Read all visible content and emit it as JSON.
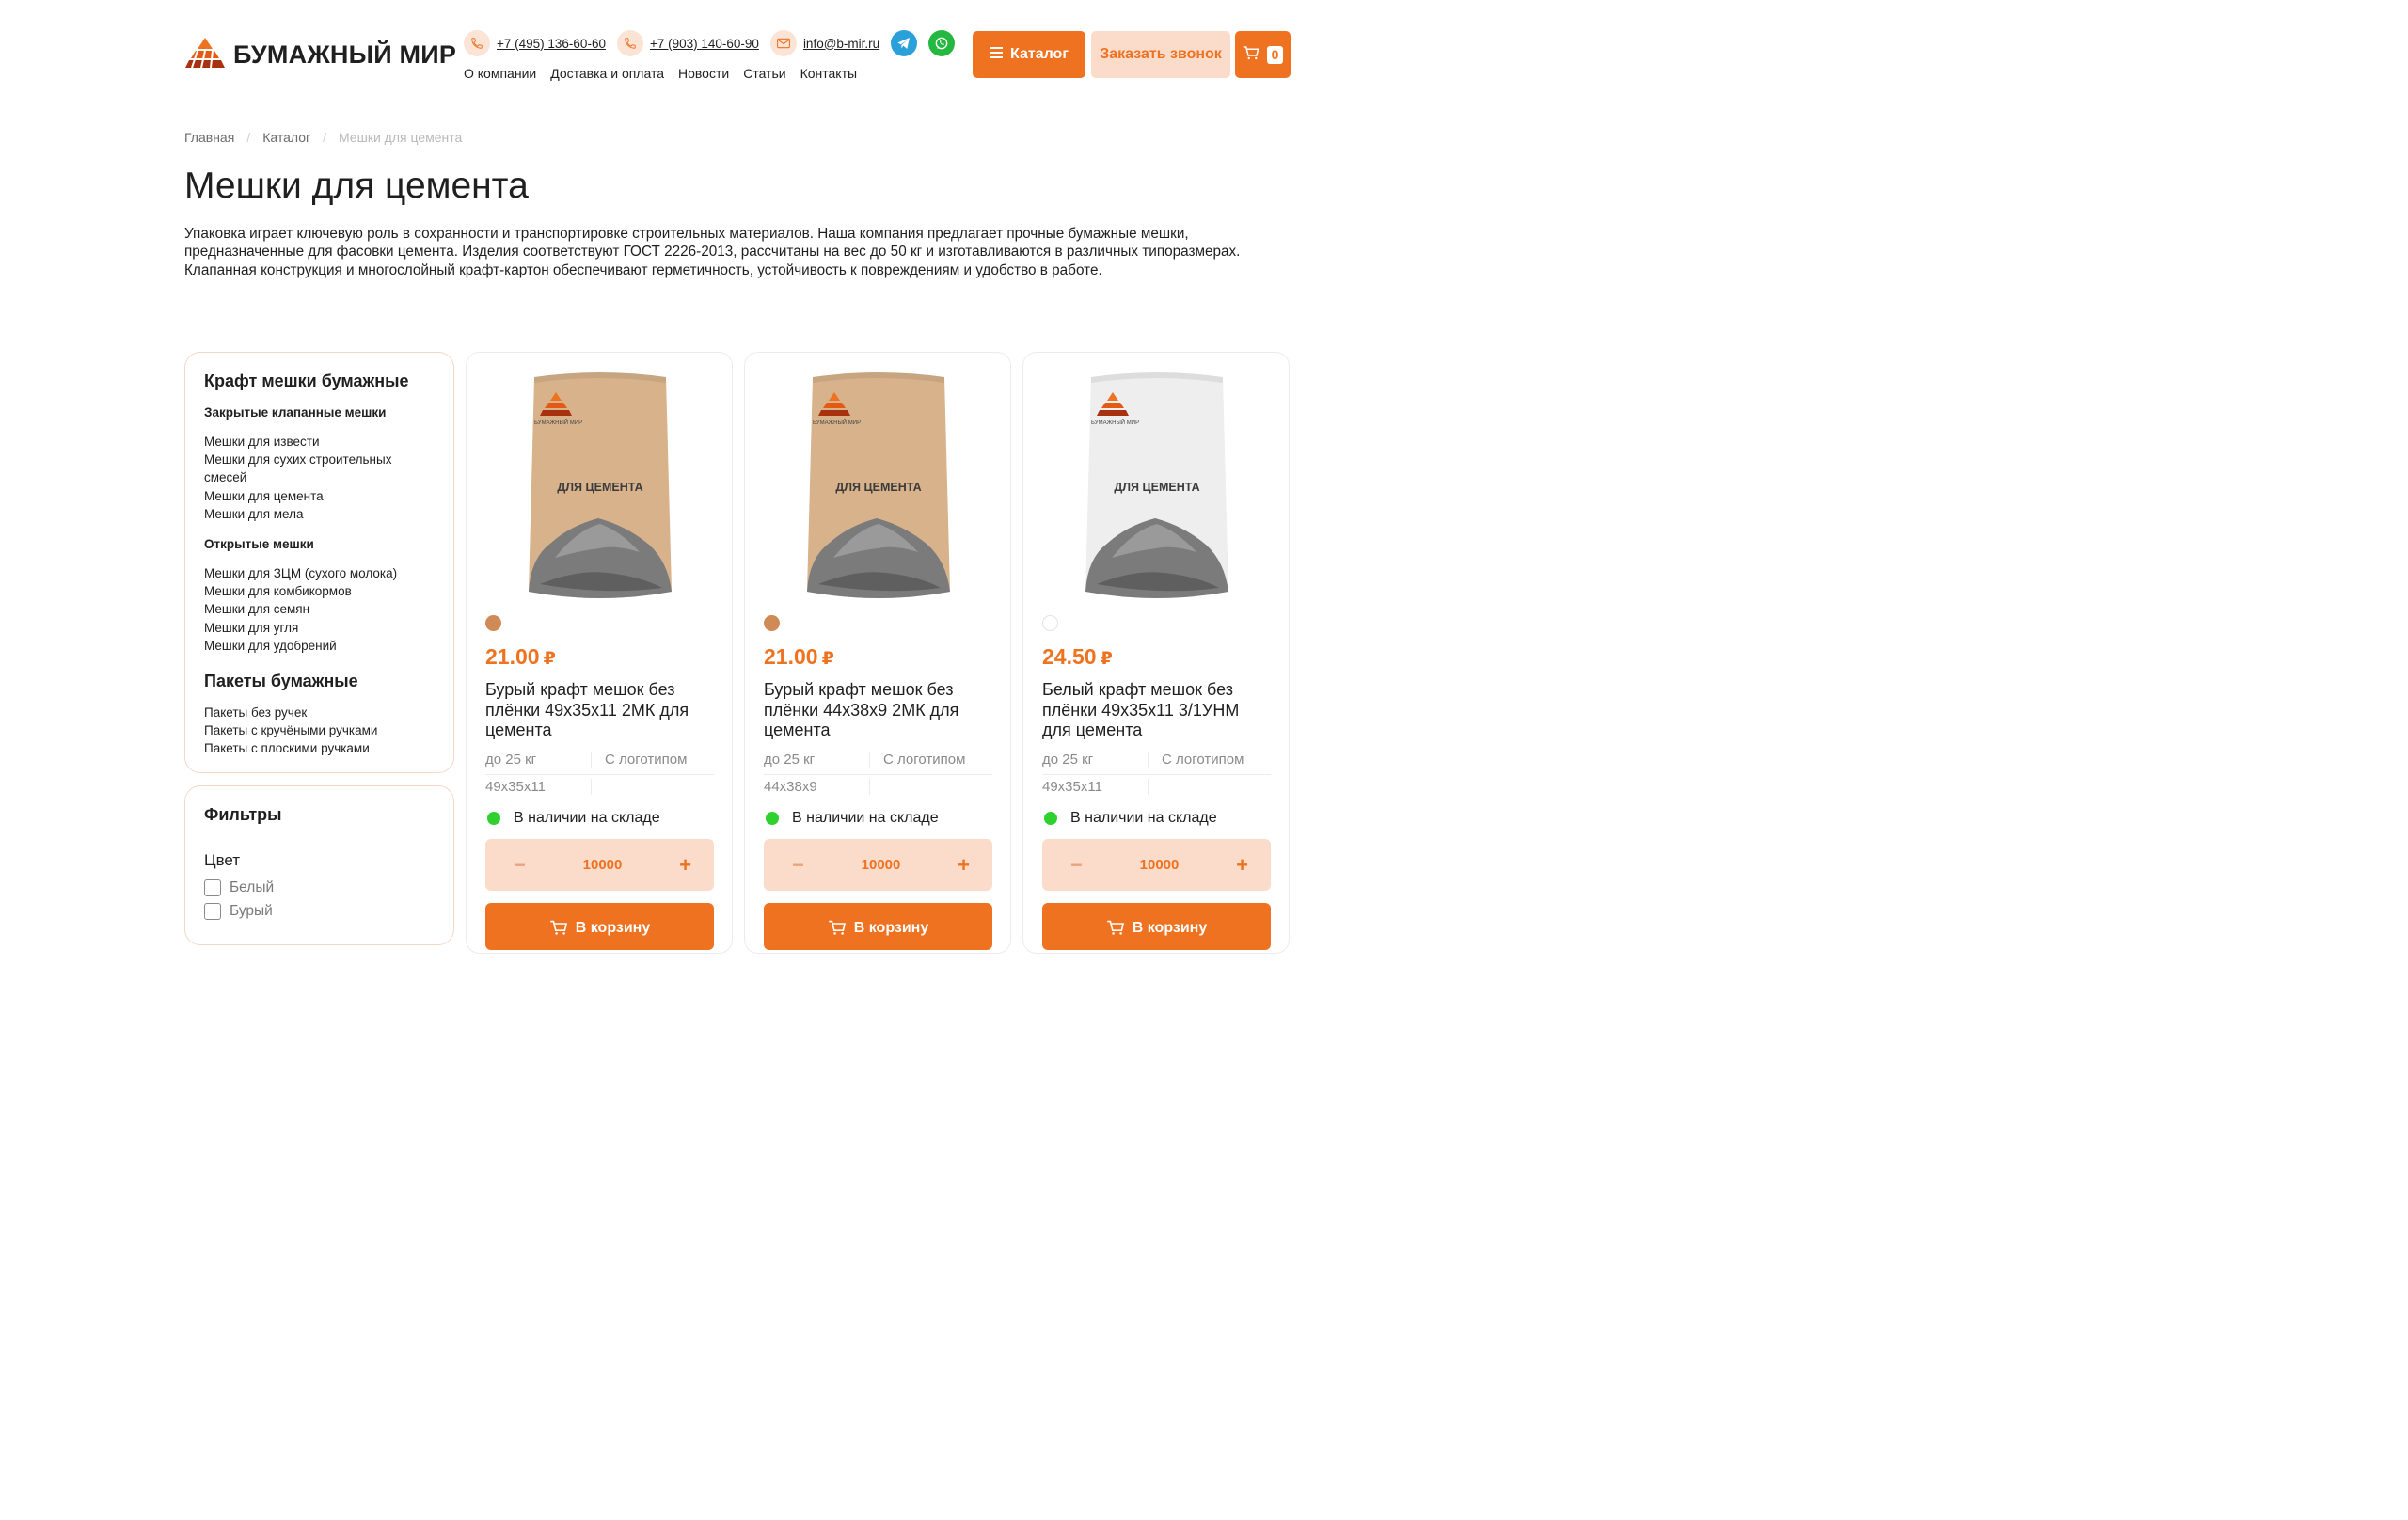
{
  "header": {
    "logo_text": "БУМАЖНЫЙ МИР",
    "phone1": "+7 (495) 136-60-60",
    "phone2": "+7 (903) 140-60-90",
    "email": "info@b-mir.ru",
    "nav": [
      "О компании",
      "Доставка и оплата",
      "Новости",
      "Статьи",
      "Контакты"
    ],
    "catalog_btn": "Каталог",
    "call_btn": "Заказать звонок",
    "cart_count": "0",
    "accent": "#ee7220"
  },
  "breadcrumb": {
    "home": "Главная",
    "catalog": "Каталог",
    "current": "Мешки для цемента"
  },
  "page": {
    "title": "Мешки для цемента",
    "description": "Упаковка играет ключевую роль в сохранности и транспортировке строительных материалов. Наша компания предлагает прочные бумажные мешки, предназначенные для фасовки цемента. Изделия соответствуют ГОСТ 2226-2013, рассчитаны на вес до 50 кг и изготавливаются в различных типоразмерах. Клапанная конструкция и многослойный крафт-картон обеспечивают герметичность, устойчивость к повреждениям и удобство в работе."
  },
  "sidebar": {
    "heading1": "Крафт мешки бумажные",
    "sub1": "Закрытые клапанные мешки",
    "group1": [
      "Мешки для извести",
      "Мешки для сухих строительных смесей",
      "Мешки для цемента",
      "Мешки для мела"
    ],
    "sub2": "Открытые мешки",
    "group2": [
      "Мешки для ЗЦМ (сухого молока)",
      "Мешки для комбикормов",
      "Мешки для семян",
      "Мешки для угля",
      "Мешки для удобрений"
    ],
    "heading2": "Пакеты бумажные",
    "group3": [
      "Пакеты без ручек",
      "Пакеты с кручёными ручками",
      "Пакеты с плоскими ручками"
    ]
  },
  "filters": {
    "title": "Фильтры",
    "color_label": "Цвет",
    "options": [
      "Белый",
      "Бурый"
    ]
  },
  "products": [
    {
      "swatch_color": "#d08a55",
      "bag_color": "#d7b28b",
      "bag_label": "ДЛЯ ЦЕМЕНТА",
      "bag_brand": "БУМАЖНЫЙ МИР",
      "price": "21.00",
      "currency": "₽",
      "name": "Бурый крафт мешок без плёнки 49х35х11 2МК для цемента",
      "weight": "до 25 кг",
      "logo": "С логотипом",
      "size": "49x35x11",
      "stock": "В наличии на складе",
      "qty": "10000",
      "cart_btn": "В корзину"
    },
    {
      "swatch_color": "#d08a55",
      "bag_color": "#d7b28b",
      "bag_label": "ДЛЯ ЦЕМЕНТА",
      "bag_brand": "БУМАЖНЫЙ МИР",
      "price": "21.00",
      "currency": "₽",
      "name": "Бурый крафт мешок без плёнки 44х38х9 2МК для цемента",
      "weight": "до 25 кг",
      "logo": "С логотипом",
      "size": "44x38x9",
      "stock": "В наличии на складе",
      "qty": "10000",
      "cart_btn": "В корзину"
    },
    {
      "swatch_color": "#ffffff",
      "bag_color": "#eeeeee",
      "bag_label": "ДЛЯ ЦЕМЕНТА",
      "bag_brand": "БУМАЖНЫЙ МИР",
      "price": "24.50",
      "currency": "₽",
      "name": "Белый крафт мешок без плёнки 49х35х11 3/1УНМ для цемента",
      "weight": "до 25 кг",
      "logo": "С логотипом",
      "size": "49x35x11",
      "stock": "В наличии на складе",
      "qty": "10000",
      "cart_btn": "В корзину"
    }
  ]
}
